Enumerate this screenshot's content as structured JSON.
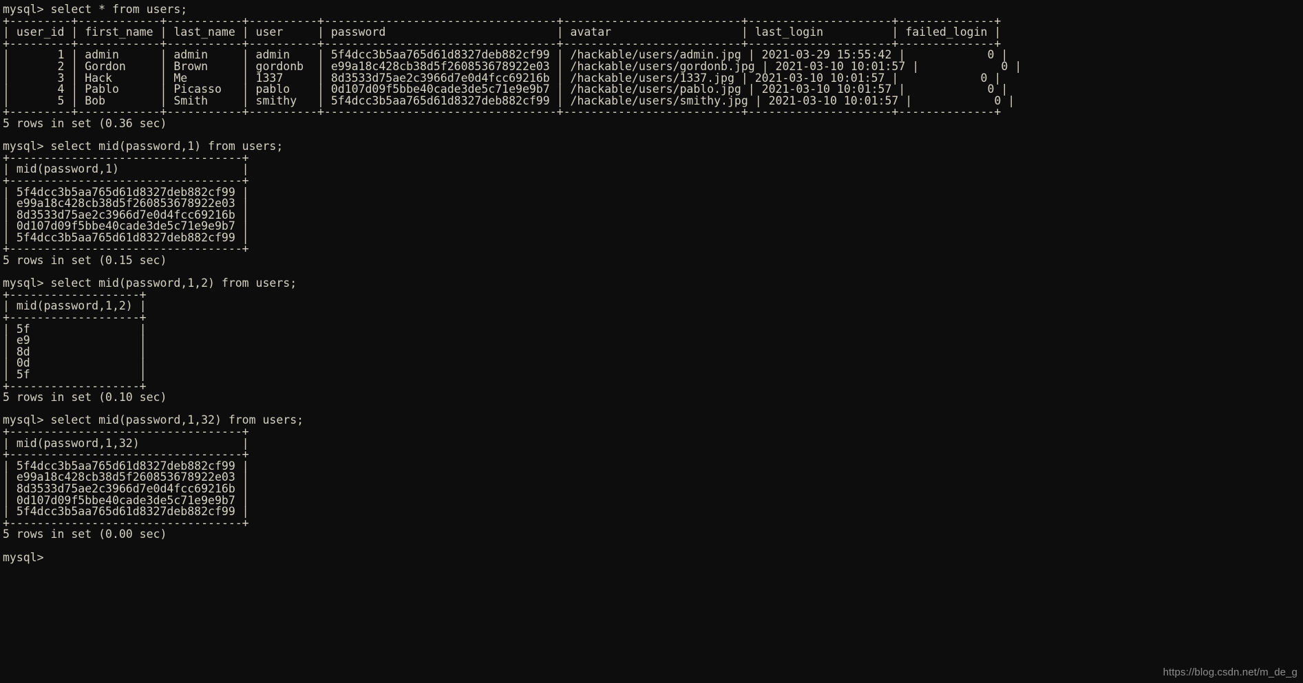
{
  "terminal": {
    "prompt": "mysql> ",
    "background_color": "#0d0d0d",
    "foreground_color": "#d6d2c4",
    "watermark": "https://blog.csdn.net/m_de_g"
  },
  "blocks": [
    {
      "name": "select-all-users",
      "command": "select * from users;",
      "table": {
        "columns": [
          "user_id",
          "first_name",
          "last_name",
          "user",
          "password",
          "avatar",
          "last_login",
          "failed_login"
        ],
        "widths": [
          9,
          12,
          11,
          10,
          34,
          26,
          21,
          14
        ],
        "aligns": [
          "right",
          "left",
          "left",
          "left",
          "left",
          "left",
          "left",
          "right"
        ],
        "rows": [
          [
            "1",
            "admin",
            "admin",
            "admin",
            "5f4dcc3b5aa765d61d8327deb882cf99",
            "/hackable/users/admin.jpg",
            "2021-03-29 15:55:42",
            "0"
          ],
          [
            "2",
            "Gordon",
            "Brown",
            "gordonb",
            "e99a18c428cb38d5f260853678922e03",
            "/hackable/users/gordonb.jpg",
            "2021-03-10 10:01:57",
            "0"
          ],
          [
            "3",
            "Hack",
            "Me",
            "1337",
            "8d3533d75ae2c3966d7e0d4fcc69216b",
            "/hackable/users/1337.jpg",
            "2021-03-10 10:01:57",
            "0"
          ],
          [
            "4",
            "Pablo",
            "Picasso",
            "pablo",
            "0d107d09f5bbe40cade3de5c71e9e9b7",
            "/hackable/users/pablo.jpg",
            "2021-03-10 10:01:57",
            "0"
          ],
          [
            "5",
            "Bob",
            "Smith",
            "smithy",
            "5f4dcc3b5aa765d61d8327deb882cf99",
            "/hackable/users/smithy.jpg",
            "2021-03-10 10:01:57",
            "0"
          ]
        ]
      },
      "status": "5 rows in set (0.36 sec)"
    },
    {
      "name": "mid-password-1",
      "command": "select mid(password,1) from users;",
      "table": {
        "columns": [
          "mid(password,1)"
        ],
        "widths": [
          34
        ],
        "aligns": [
          "left"
        ],
        "rows": [
          [
            "5f4dcc3b5aa765d61d8327deb882cf99"
          ],
          [
            "e99a18c428cb38d5f260853678922e03"
          ],
          [
            "8d3533d75ae2c3966d7e0d4fcc69216b"
          ],
          [
            "0d107d09f5bbe40cade3de5c71e9e9b7"
          ],
          [
            "5f4dcc3b5aa765d61d8327deb882cf99"
          ]
        ]
      },
      "status": "5 rows in set (0.15 sec)"
    },
    {
      "name": "mid-password-1-2",
      "command": "select mid(password,1,2) from users;",
      "table": {
        "columns": [
          "mid(password,1,2)"
        ],
        "widths": [
          19
        ],
        "aligns": [
          "left"
        ],
        "rows": [
          [
            "5f"
          ],
          [
            "e9"
          ],
          [
            "8d"
          ],
          [
            "0d"
          ],
          [
            "5f"
          ]
        ]
      },
      "status": "5 rows in set (0.10 sec)"
    },
    {
      "name": "mid-password-1-32",
      "command": "select mid(password,1,32) from users;",
      "table": {
        "columns": [
          "mid(password,1,32)"
        ],
        "widths": [
          34
        ],
        "aligns": [
          "left"
        ],
        "rows": [
          [
            "5f4dcc3b5aa765d61d8327deb882cf99"
          ],
          [
            "e99a18c428cb38d5f260853678922e03"
          ],
          [
            "8d3533d75ae2c3966d7e0d4fcc69216b"
          ],
          [
            "0d107d09f5bbe40cade3de5c71e9e9b7"
          ],
          [
            "5f4dcc3b5aa765d61d8327deb882cf99"
          ]
        ]
      },
      "status": "5 rows in set (0.00 sec)"
    }
  ],
  "final_prompt": "mysql>"
}
